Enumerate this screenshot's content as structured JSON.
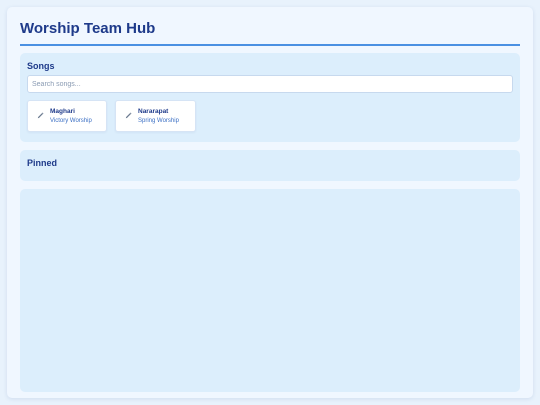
{
  "app": {
    "title": "Worship Team Hub"
  },
  "songs_panel": {
    "heading": "Songs",
    "search": {
      "placeholder": "Search songs...",
      "value": ""
    },
    "items": [
      {
        "name": "Maghari",
        "artist": "Victory Worship",
        "icon": "pencil-icon"
      },
      {
        "name": "Nararapat",
        "artist": "Spring Worship",
        "icon": "pencil-icon"
      }
    ]
  },
  "pinned_panel": {
    "heading": "Pinned"
  },
  "colors": {
    "accent": "#4a90e2",
    "heading": "#1e3a8a",
    "panel": "#dceefc",
    "background": "#f0f7ff"
  }
}
